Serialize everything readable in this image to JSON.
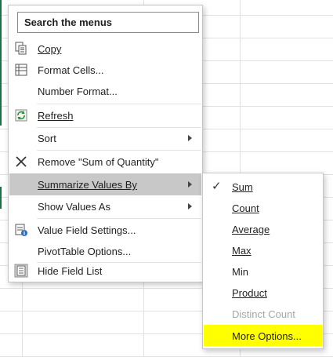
{
  "search": {
    "placeholder": "Search the menus"
  },
  "context_menu": {
    "items": [
      {
        "label": "Copy",
        "icon": "copy-icon"
      },
      {
        "label": "Format Cells...",
        "icon": "format-cells-icon"
      },
      {
        "label": "Number Format..."
      },
      {
        "label": "Refresh",
        "icon": "refresh-icon"
      },
      {
        "label": "Sort",
        "has_submenu": true
      },
      {
        "label": "Remove \"Sum of Quantity\"",
        "icon": "remove-x-icon"
      },
      {
        "label": "Summarize Values By",
        "has_submenu": true,
        "active": true
      },
      {
        "label": "Show Values As",
        "has_submenu": true
      },
      {
        "label": "Value Field Settings...",
        "icon": "value-field-settings-icon"
      },
      {
        "label": "PivotTable Options..."
      },
      {
        "label": "Hide Field List",
        "icon": "field-list-icon"
      }
    ]
  },
  "submenu": {
    "items": [
      {
        "label": "Sum",
        "checked": true
      },
      {
        "label": "Count"
      },
      {
        "label": "Average"
      },
      {
        "label": "Max"
      },
      {
        "label": "Min"
      },
      {
        "label": "Product"
      },
      {
        "label": "Distinct Count",
        "disabled": true
      },
      {
        "label": "More Options...",
        "highlighted": true
      }
    ]
  },
  "colors": {
    "active_item_bg": "#c8c8c8",
    "highlight_bg": "#ffff00",
    "grid_line": "#e1e1e1",
    "selection_green": "#1e7145"
  }
}
